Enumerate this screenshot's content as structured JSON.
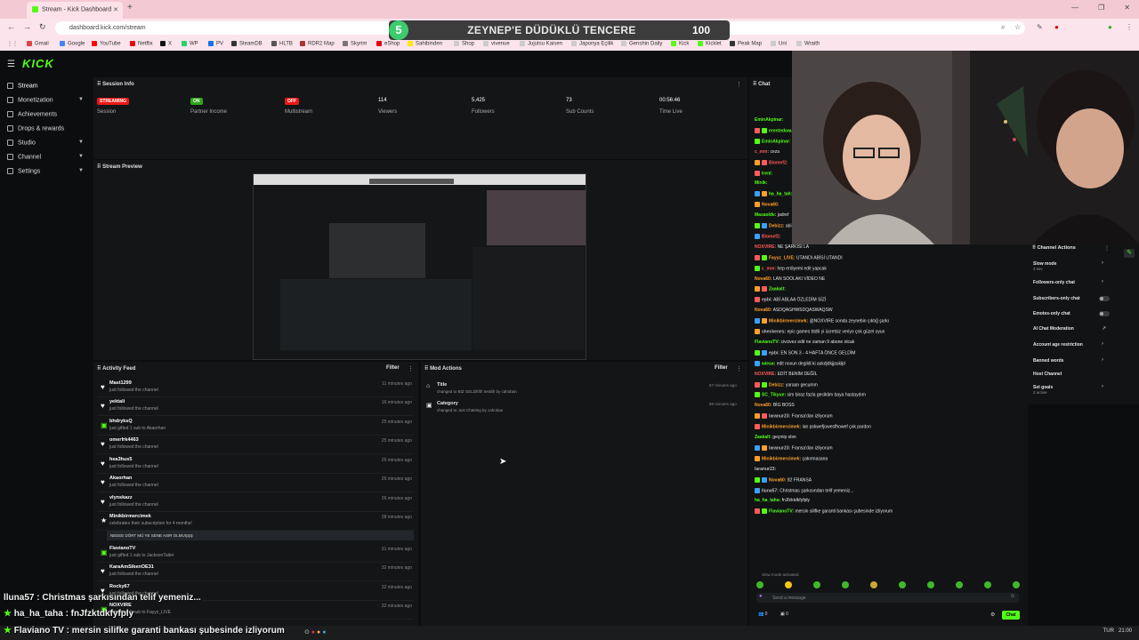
{
  "browser": {
    "tab_title": "Stream - Kick Dashboard",
    "url": "dashboard.kick.com/stream",
    "new_tab": "+",
    "bookmarks": [
      "Gmail",
      "Google",
      "YouTube",
      "Netflix",
      "X",
      "WP",
      "PV",
      "SteamDB",
      "HLTB",
      "RDR2 Map",
      "Skyrim",
      "eShop",
      "Sahibinden",
      "Shop",
      "vivenue",
      "Jujutsu Kaisen",
      "Japonya Eçilik",
      "Genshin Daily",
      "Kick",
      "Kicklet",
      "Peak Map",
      "Uni",
      "Wraith"
    ]
  },
  "banner": {
    "number": "5",
    "title": "ZEYNEP'E DÜDÜKLÜ TENCERE",
    "score": "100"
  },
  "colors": {
    "accent": "#53fc18",
    "live": "#e91916",
    "panel": "#131516",
    "bg": "#0b0d0e"
  },
  "sidebar": {
    "logo": "KICK",
    "items": [
      {
        "label": "Stream",
        "icon": "broadcast-icon"
      },
      {
        "label": "Monetization",
        "icon": "dollar-icon"
      },
      {
        "label": "Achievements",
        "icon": "trophy-icon"
      },
      {
        "label": "Drops & rewards",
        "icon": "gift-icon"
      },
      {
        "label": "Studio",
        "icon": "film-icon"
      },
      {
        "label": "Channel",
        "icon": "tv-icon"
      },
      {
        "label": "Settings",
        "icon": "gear-icon"
      }
    ]
  },
  "session": {
    "title": "Session Info",
    "stats": [
      {
        "value": "STREAMING",
        "label": "Session"
      },
      {
        "value": "ON",
        "label": "Partner Income"
      },
      {
        "value": "OFF",
        "label": "Multistream"
      },
      {
        "value": "114",
        "label": "Viewers"
      },
      {
        "value": "5,425",
        "label": "Followers"
      },
      {
        "value": "73",
        "label": "Sub Counts"
      },
      {
        "value": "00:56:46",
        "label": "Time Live"
      }
    ]
  },
  "preview": {
    "title": "Stream Preview"
  },
  "activity": {
    "title": "Activity Feed",
    "filter": "Filter",
    "rows": [
      {
        "name": "Mast1299",
        "desc": "just followed the channel",
        "time": "11 minutes ago"
      },
      {
        "name": "yektali",
        "desc": "just followed the channel",
        "time": "16 minutes ago"
      },
      {
        "name": "bhdryksQ",
        "desc": "just gifted 1 sub to Akaorhan",
        "time": "25 minutes ago"
      },
      {
        "name": "omerfrk4463",
        "desc": "just followed the channel",
        "time": "25 minutes ago"
      },
      {
        "name": "hea3hus5",
        "desc": "just followed the channel",
        "time": "26 minutes ago"
      },
      {
        "name": "Akaorhan",
        "desc": "just followed the channel",
        "time": "26 minutes ago"
      },
      {
        "name": "vlynskazz",
        "desc": "just followed the channel",
        "time": "26 minutes ago"
      },
      {
        "name": "Minikbirmercimek",
        "desc": "celebrates their subscription for 4 months!",
        "time": "28 minutes ago"
      },
      {
        "name": "FlavianoTV",
        "desc": "just gifted 1 sub to JacksonTaiter",
        "time": "31 minutes ago"
      },
      {
        "name": "KaraAmSikenOE31",
        "desc": "just followed the channel",
        "time": "32 minutes ago"
      },
      {
        "name": "Rocky67",
        "desc": "just followed the channel",
        "time": "32 minutes ago"
      },
      {
        "name": "NOXVIRE",
        "desc": "just gifted 1 sub to Fayyz_LIVE",
        "time": "32 minutes ago"
      }
    ],
    "sub_message": "NEEEE DÖRT MÜ YE SENE ASIR OLMUŞŞŞ"
  },
  "mod": {
    "title": "Mod Actions",
    "filter": "Filter",
    "rows": [
      {
        "name": "Title",
        "desc": "changed to BİZ GELDİİİİİ! teralth by cahoban",
        "time": "57 minutes ago"
      },
      {
        "name": "Category",
        "desc": "changed to Just Chatting by cahoban",
        "time": "58 minutes ago"
      }
    ]
  },
  "chat": {
    "title": "Chat",
    "lines": [
      {
        "user": "EminAkpinar:",
        "msg": "",
        "color": "#53fc18"
      },
      {
        "user": "erentedoauz:",
        "msg": "",
        "color": "#53fc18"
      },
      {
        "user": "EminAkpinar:",
        "msg": "",
        "color": "#53fc18"
      },
      {
        "user": "c_mm:",
        "msg": "ceza",
        "color": "#ff5a5a"
      },
      {
        "user": "Biomef2:",
        "msg": "",
        "color": "#ff5a5a"
      },
      {
        "user": "Irenl:",
        "msg": "",
        "color": "#53fc18"
      },
      {
        "user": "Minik:",
        "msg": "",
        "color": "#53fc18"
      },
      {
        "user": "ha_ha_tah:",
        "msg": "",
        "color": "#53fc18"
      },
      {
        "user": "Nova60:",
        "msg": "",
        "color": "#ff9f2b"
      },
      {
        "user": "Masaolde:",
        "msg": "jadref",
        "color": "#53fc18"
      },
      {
        "user": "Debizz:",
        "msg": "abi ne z",
        "color": "#ff9f2b"
      },
      {
        "user": "Biomef2:",
        "msg": "",
        "color": "#ff5a5a"
      },
      {
        "user": "NOXVIRE:",
        "msg": "NE ŞARKISI LA",
        "color": "#ff5a5a"
      },
      {
        "user": "Fayyz_LIVE:",
        "msg": "UTANDI ABİSİ UTANDI",
        "color": "#ff9f2b"
      },
      {
        "user": "c_mm:",
        "msg": "hep erdiyemi edit yapcak",
        "color": "#ff5a5a"
      },
      {
        "user": "Nova60:",
        "msg": "LAN SOOLAKI VİDEO NE",
        "color": "#ff9f2b"
      },
      {
        "user": "Zaakalt:",
        "msg": "",
        "color": "#53fc18"
      },
      {
        "user": "epbi:",
        "msg": "ABİ ABLAA ÖZLEDİM SİZİ",
        "color": "#bbbbbb"
      },
      {
        "user": "Nova60:",
        "msg": "ASDQAGHWSDQASWAQSW",
        "color": "#ff9f2b"
      },
      {
        "user": "Minikbirmercimek:",
        "msg": "@NOXVIRE sonda zeynebin çıktığ şarkı",
        "color": "#ff9f2b"
      },
      {
        "user": "sheckenes:",
        "msg": "epic games btd6 yi ücretsiz veriyo çok güzel oyun",
        "color": "#bbbbbb"
      },
      {
        "user": "FlavianoTV:",
        "msg": "civcivez edit ne zaman 9 abone olcak",
        "color": "#53fc18"
      },
      {
        "user": "epbi:",
        "msg": "EN SON 3 - 4 HAFTA ÖNCE GELDİM",
        "color": "#bbbbbb"
      },
      {
        "user": "wiesa:",
        "msg": "edit noxun degildi ki askdjdkjjaskljd",
        "color": "#53fc18"
      },
      {
        "user": "NOXVIRE:",
        "msg": "EDİT BENİM DEĞİL",
        "color": "#ff5a5a"
      },
      {
        "user": "Debizz:",
        "msg": "yaraan gecumm",
        "color": "#ff9f2b"
      },
      {
        "user": "SC_Tikyue:",
        "msg": "sim biraz fazla geciktim baya hastaydım",
        "color": "#53fc18"
      },
      {
        "user": "Nova60:",
        "msg": "BİG BOSS",
        "color": "#ff9f2b"
      },
      {
        "user": "laranur23:",
        "msg": "Fransa'dan izliyorum",
        "color": "#bbbbbb"
      },
      {
        "user": "Minikbirmercimek:",
        "msg": "ian pskwefjowesfhowef çok pardon",
        "color": "#ff9f2b"
      },
      {
        "user": "Zaakalt:",
        "msg": "geçmiş olsn",
        "color": "#53fc18"
      },
      {
        "user": "laranur23:",
        "msg": "Fransa'dan izliyorum",
        "color": "#bbbbbb"
      },
      {
        "user": "Minikbirmercimek:",
        "msg": "çakırmasana",
        "color": "#ff9f2b"
      },
      {
        "user": "laranur23:",
        "msg": "",
        "color": "#bbbbbb"
      },
      {
        "user": "Nova60:",
        "msg": "82 FRANSA",
        "color": "#ff9f2b"
      },
      {
        "user": "lluna57:",
        "msg": "Christmas şarkısından telif yemeniz...",
        "color": "#bbbbbb"
      },
      {
        "user": "ha_ha_taha:",
        "msg": "fnJfzktdkfyfply",
        "color": "#53fc18"
      },
      {
        "user": "FlavianoTV:",
        "msg": "mersin silifke garanti bankası şubesinde izliyorum",
        "color": "#53fc18"
      }
    ],
    "slow_mode": "Slow mode activated",
    "placeholder": "Send a message",
    "send": "Chat",
    "viewer_count": "0"
  },
  "channel_actions": {
    "title": "Channel Actions",
    "items": [
      {
        "label": "Slow mode",
        "sub": "3 sec",
        "control": "chevron"
      },
      {
        "label": "Followers-only chat",
        "sub": "",
        "control": "chevron"
      },
      {
        "label": "Subscribers-only chat",
        "sub": "",
        "control": "toggle"
      },
      {
        "label": "Emotes-only chat",
        "sub": "",
        "control": "toggle"
      },
      {
        "label": "AI Chat Moderation",
        "sub": "",
        "control": "link"
      },
      {
        "label": "Account age restriction",
        "sub": "",
        "control": "chevron"
      },
      {
        "label": "Banned words",
        "sub": "",
        "control": "chevron"
      },
      {
        "label": "Host Channel",
        "sub": "",
        "control": "none"
      },
      {
        "label": "Set goals",
        "sub": "2 active",
        "control": "chevron"
      }
    ]
  },
  "overlay": {
    "lines": [
      {
        "user": "lluna57",
        "msg": ": Christmas şarkısından telif yemeniz..."
      },
      {
        "user": "ha_ha_taha",
        "msg": ": fnJfzktdkfyfply"
      },
      {
        "user": "Flaviano TV",
        "msg": ": mersin silifke garanti bankası şubesinde izliyorum"
      }
    ]
  },
  "taskbar": {
    "lang": "TUR",
    "time": "21:00"
  }
}
